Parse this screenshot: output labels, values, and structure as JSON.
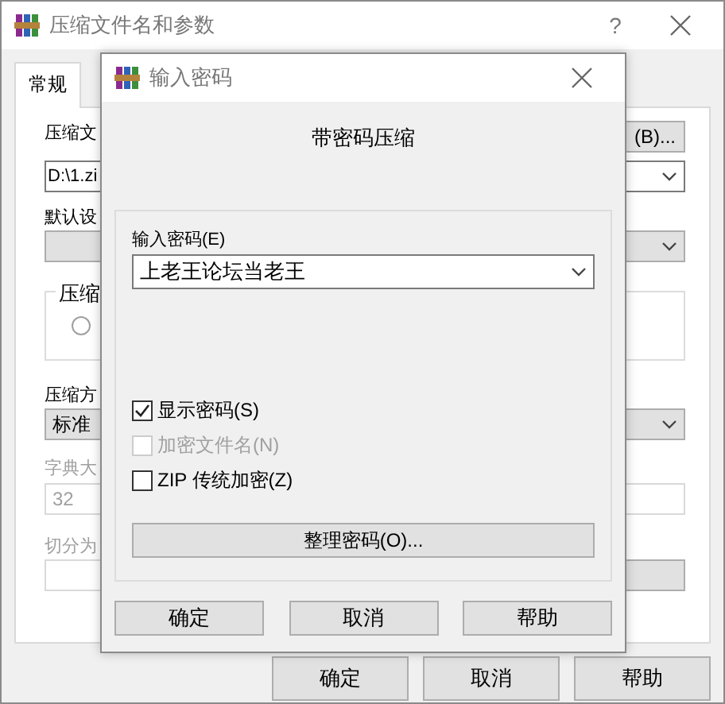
{
  "window": {
    "title": "压缩文件名和参数",
    "help": "?"
  },
  "tabs": [
    {
      "label": "常规",
      "selected": true
    }
  ],
  "general": {
    "archive_name_label": "压缩文",
    "browse_button": "(B)...",
    "archive_name": "D:\\1.zi",
    "profile_label": "默认设",
    "format_group_label": "压缩",
    "format_option": {
      "selected": false
    },
    "method_label": "压缩方",
    "method": "标准",
    "dictionary": {
      "label": "字典大",
      "value": "32",
      "disabled": true
    },
    "split": {
      "label": "切分为",
      "disabled": true
    }
  },
  "buttons": [
    "确定",
    "取消",
    "帮助"
  ],
  "password_dialog": {
    "title": "输入密码",
    "heading": "带密码压缩",
    "password_label": "输入密码(E)",
    "password": "上老王论坛当老王",
    "options": [
      {
        "label": "显示密码(S)",
        "checked": true,
        "disabled": false
      },
      {
        "label": "加密文件名(N)",
        "checked": false,
        "disabled": true
      },
      {
        "label": "ZIP 传统加密(Z)",
        "checked": false,
        "disabled": false
      }
    ],
    "organize_button": "整理密码(O)...",
    "buttons": [
      "确定",
      "取消",
      "帮助"
    ]
  }
}
